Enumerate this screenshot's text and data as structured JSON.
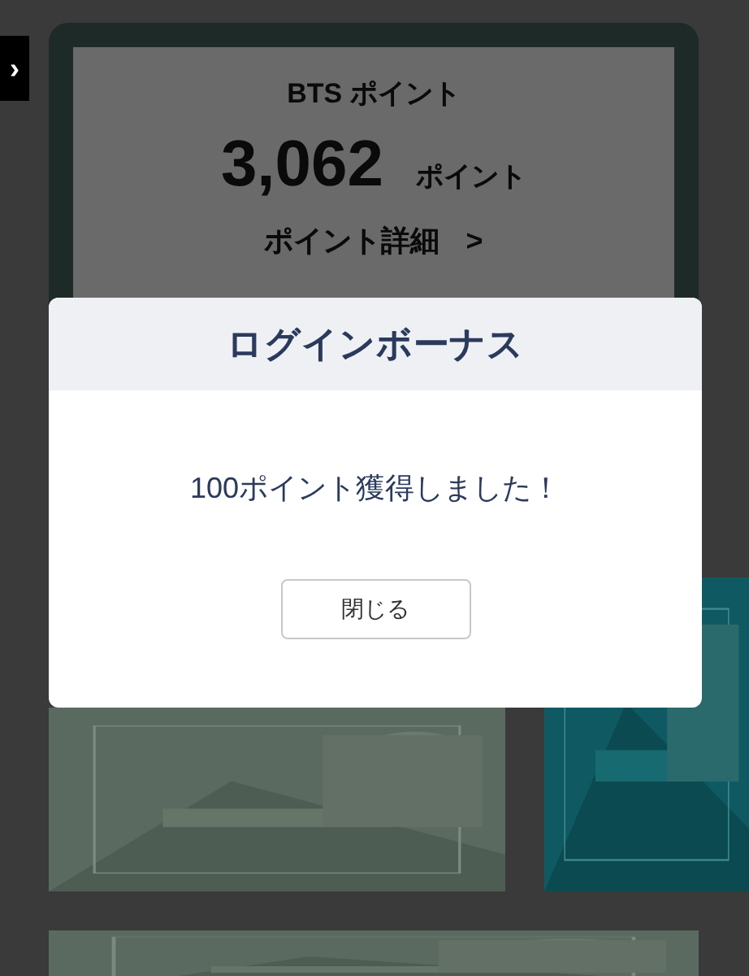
{
  "side_tab": {
    "label": "›"
  },
  "points_card": {
    "title": "BTS ポイント",
    "amount": "3,062",
    "unit": "ポイント",
    "detail_link": "ポイント詳細",
    "detail_arrow": ">"
  },
  "modal": {
    "title": "ログインボーナス",
    "message": "100ポイント獲得しました！",
    "button": "閉じる"
  }
}
